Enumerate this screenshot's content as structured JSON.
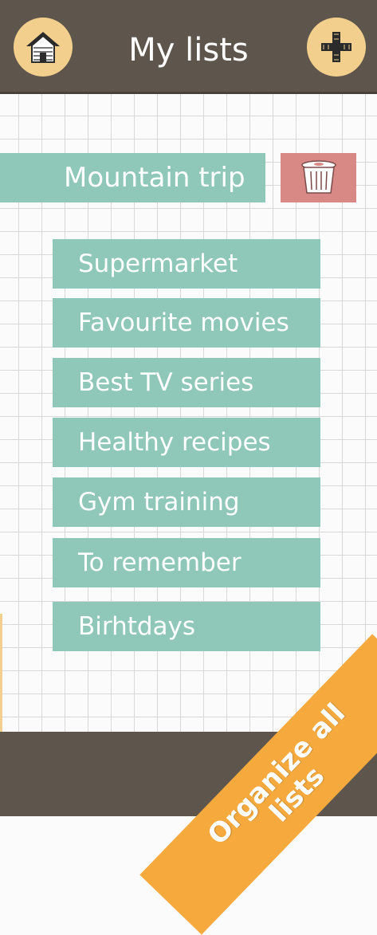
{
  "header": {
    "title": "My lists"
  },
  "selected_list": {
    "label": "Mountain trip"
  },
  "lists": [
    {
      "label": "Supermarket"
    },
    {
      "label": "Favourite movies"
    },
    {
      "label": "Best TV series"
    },
    {
      "label": "Healthy recipes"
    },
    {
      "label": "Gym training"
    },
    {
      "label": "To remember"
    },
    {
      "label": "Birhtdays"
    }
  ],
  "banner": {
    "line1": "Organize all",
    "line2": "lists"
  },
  "colors": {
    "header_bg": "#5e554c",
    "button_bg": "#f2cf8c",
    "item_bg": "#8fc7b8",
    "delete_bg": "#d98985",
    "banner_bg": "#f6aa3e"
  },
  "icons": {
    "home": "home-icon",
    "add": "plus-icon",
    "delete": "trash-icon"
  }
}
